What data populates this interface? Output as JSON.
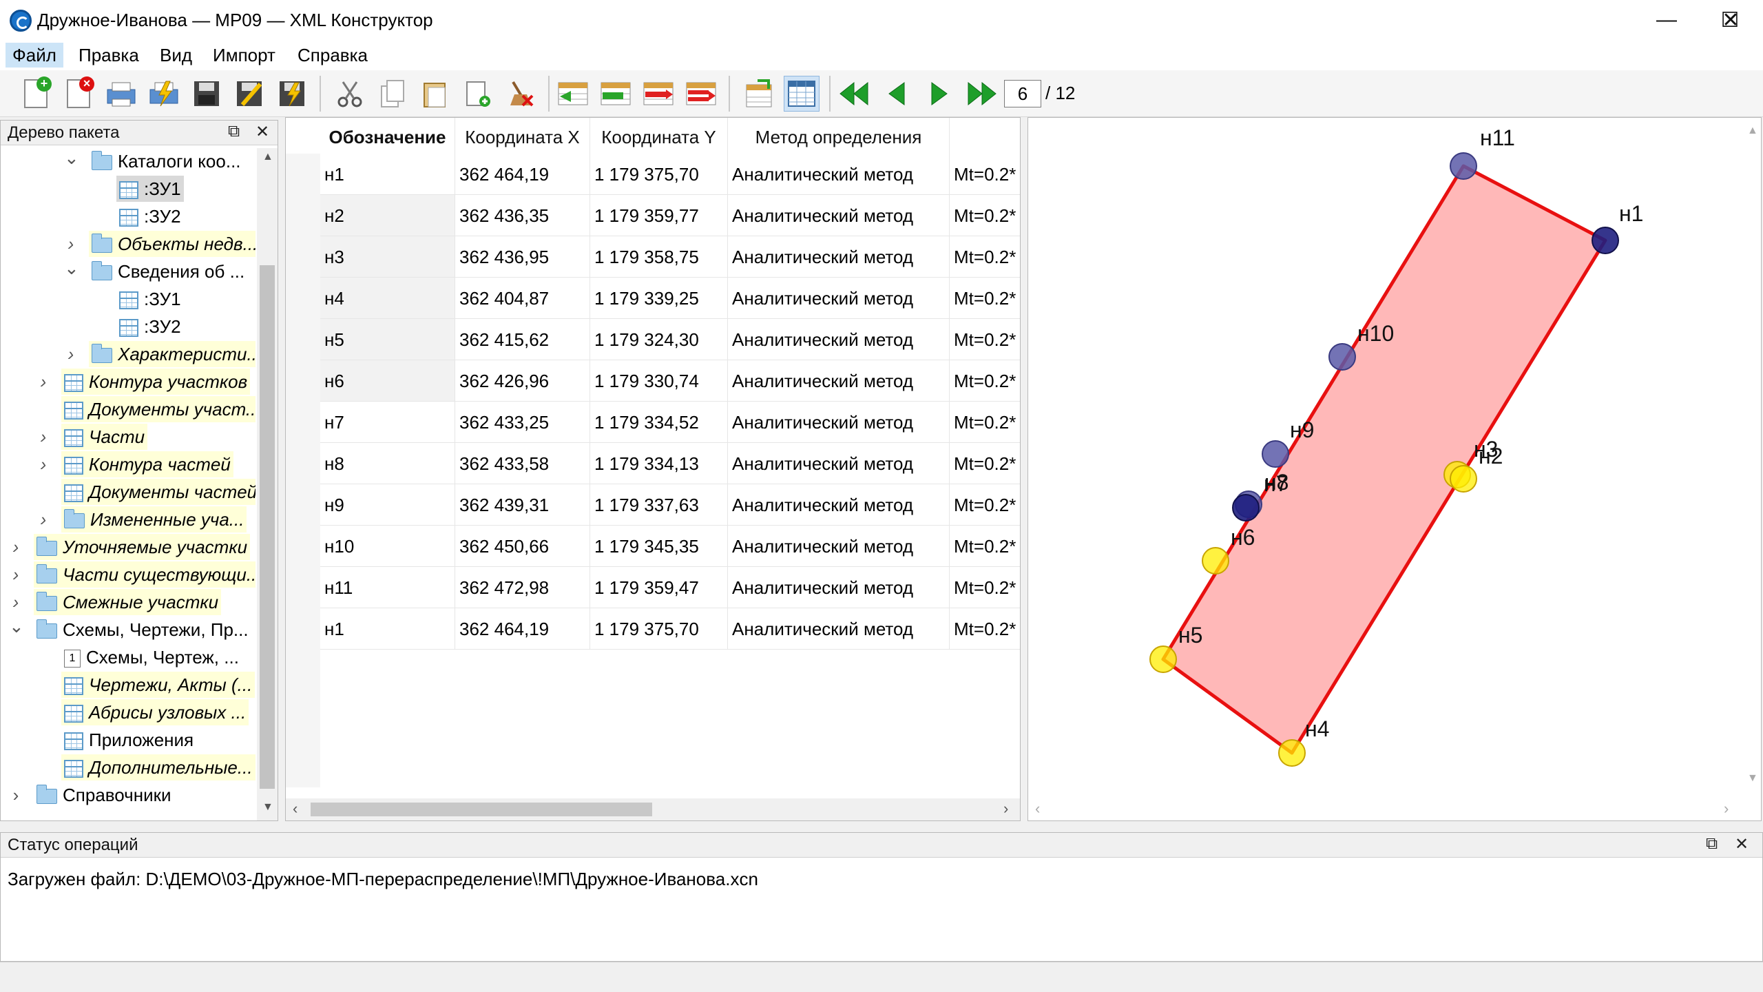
{
  "window": {
    "title": "Дружное-Иванова — МР09 — XML Конструктор",
    "minimize": "—",
    "maximize": "☐",
    "close": "✕"
  },
  "menu": [
    "Файл",
    "Правка",
    "Вид",
    "Импорт",
    "Справка"
  ],
  "toolbar": {
    "current_page": "6",
    "total_pages": "/ 12"
  },
  "tree": {
    "title": "Дерево пакета",
    "items": [
      {
        "label": "Каталоги коо...",
        "icon": "folder-icon",
        "expanded": true,
        "hl": false,
        "italic": false
      },
      {
        "label": ":ЗУ1",
        "icon": "table-icon",
        "expanded": null,
        "hl": false,
        "italic": false,
        "selected": true
      },
      {
        "label": ":ЗУ2",
        "icon": "table-icon",
        "expanded": null,
        "hl": false,
        "italic": false
      },
      {
        "label": "Объекты недв...",
        "icon": "folder-icon",
        "expanded": false,
        "hl": true,
        "italic": true
      },
      {
        "label": "Сведения об ...",
        "icon": "folder-icon",
        "expanded": true,
        "hl": false,
        "italic": false
      },
      {
        "label": ":ЗУ1",
        "icon": "table-icon",
        "expanded": null,
        "hl": false,
        "italic": false
      },
      {
        "label": ":ЗУ2",
        "icon": "table-icon",
        "expanded": null,
        "hl": false,
        "italic": false
      },
      {
        "label": "Характеристи...",
        "icon": "folder-icon",
        "expanded": false,
        "hl": true,
        "italic": true
      },
      {
        "label": "Контура участков",
        "icon": "table-icon",
        "expanded": false,
        "hl": true,
        "italic": true
      },
      {
        "label": "Документы участ...",
        "icon": "table-icon",
        "expanded": null,
        "hl": true,
        "italic": true
      },
      {
        "label": "Части",
        "icon": "table-icon",
        "expanded": false,
        "hl": true,
        "italic": true
      },
      {
        "label": "Контура частей",
        "icon": "table-icon",
        "expanded": false,
        "hl": true,
        "italic": true
      },
      {
        "label": "Документы частей",
        "icon": "table-icon",
        "expanded": null,
        "hl": true,
        "italic": true
      },
      {
        "label": "Измененные уча...",
        "icon": "folder-icon",
        "expanded": false,
        "hl": true,
        "italic": true
      },
      {
        "label": "Уточняемые участки",
        "icon": "folder-icon",
        "expanded": false,
        "hl": true,
        "italic": true
      },
      {
        "label": "Части существующи...",
        "icon": "folder-icon",
        "expanded": false,
        "hl": true,
        "italic": true
      },
      {
        "label": "Смежные участки",
        "icon": "folder-icon",
        "expanded": false,
        "hl": true,
        "italic": true
      },
      {
        "label": "Схемы, Чертежи, Пр...",
        "icon": "folder-icon",
        "expanded": true,
        "hl": false,
        "italic": false
      },
      {
        "label": "Схемы, Чертеж, ...",
        "icon": "number-icon",
        "icon_text": "1",
        "expanded": null,
        "hl": false,
        "italic": false
      },
      {
        "label": "Чертежи, Акты (...",
        "icon": "table-icon",
        "expanded": null,
        "hl": true,
        "italic": true
      },
      {
        "label": "Абрисы узловых ...",
        "icon": "table-icon",
        "expanded": null,
        "hl": true,
        "italic": true
      },
      {
        "label": "Приложения",
        "icon": "table-icon",
        "expanded": null,
        "hl": false,
        "italic": false
      },
      {
        "label": "Дополнительные...",
        "icon": "table-icon",
        "expanded": null,
        "hl": true,
        "italic": true
      },
      {
        "label": "Справочники",
        "icon": "folder-icon",
        "expanded": false,
        "hl": false,
        "italic": false
      }
    ]
  },
  "grid": {
    "headers": [
      "Обозначение",
      "Координата X",
      "Координата Y",
      "Метод определения",
      ""
    ],
    "rows": [
      {
        "n": "1",
        "bold": false,
        "cells": [
          "н1",
          "362 464,19",
          "1 179 375,70",
          "Аналитический метод",
          "Mt=0.2*"
        ]
      },
      {
        "n": "2",
        "bold": true,
        "cells": [
          "н2",
          "362 436,35",
          "1 179 359,77",
          "Аналитический метод",
          "Mt=0.2*"
        ]
      },
      {
        "n": "3",
        "bold": true,
        "cells": [
          "н3",
          "362 436,95",
          "1 179 358,75",
          "Аналитический метод",
          "Mt=0.2*"
        ]
      },
      {
        "n": "4",
        "bold": true,
        "cells": [
          "н4",
          "362 404,87",
          "1 179 339,25",
          "Аналитический метод",
          "Mt=0.2*"
        ]
      },
      {
        "n": "5",
        "bold": true,
        "cells": [
          "н5",
          "362 415,62",
          "1 179 324,30",
          "Аналитический метод",
          "Mt=0.2*"
        ]
      },
      {
        "n": "6",
        "bold": true,
        "cells": [
          "н6",
          "362 426,96",
          "1 179 330,74",
          "Аналитический метод",
          "Mt=0.2*"
        ]
      },
      {
        "n": "7",
        "bold": false,
        "cells": [
          "н7",
          "362 433,25",
          "1 179 334,52",
          "Аналитический метод",
          "Mt=0.2*"
        ]
      },
      {
        "n": "8",
        "bold": false,
        "cells": [
          "н8",
          "362 433,58",
          "1 179 334,13",
          "Аналитический метод",
          "Mt=0.2*"
        ]
      },
      {
        "n": "9",
        "bold": false,
        "cells": [
          "н9",
          "362 439,31",
          "1 179 337,63",
          "Аналитический метод",
          "Mt=0.2*"
        ]
      },
      {
        "n": "10",
        "bold": false,
        "cells": [
          "н10",
          "362 450,66",
          "1 179 345,35",
          "Аналитический метод",
          "Mt=0.2*"
        ]
      },
      {
        "n": "11",
        "bold": false,
        "cells": [
          "н11",
          "362 472,98",
          "1 179 359,47",
          "Аналитический метод",
          "Mt=0.2*"
        ]
      },
      {
        "n": "12",
        "bold": false,
        "cells": [
          "н1",
          "362 464,19",
          "1 179 375,70",
          "Аналитический метод",
          "Mt=0.2*"
        ]
      }
    ]
  },
  "map": {
    "polygon_fill": "#ffb8b8",
    "polygon_stroke": "#e81010",
    "points": [
      {
        "label": "н11",
        "color": "dark"
      },
      {
        "label": "н1",
        "color": "navy"
      },
      {
        "label": "н10",
        "color": "dark"
      },
      {
        "label": "н9",
        "color": "dark"
      },
      {
        "label": "н8",
        "color": "dark"
      },
      {
        "label": "н7",
        "color": "navy"
      },
      {
        "label": "н3",
        "color": "yellow"
      },
      {
        "label": "н2",
        "color": "yellow"
      },
      {
        "label": "н6",
        "color": "yellow"
      },
      {
        "label": "н5",
        "color": "yellow"
      },
      {
        "label": "н4",
        "color": "yellow"
      }
    ]
  },
  "status": {
    "title": "Статус операций",
    "message": "Загружен файл: D:\\ДЕМО\\03-Дружное-МП-перераспределение\\!МП\\Дружное-Иванова.xcn"
  }
}
